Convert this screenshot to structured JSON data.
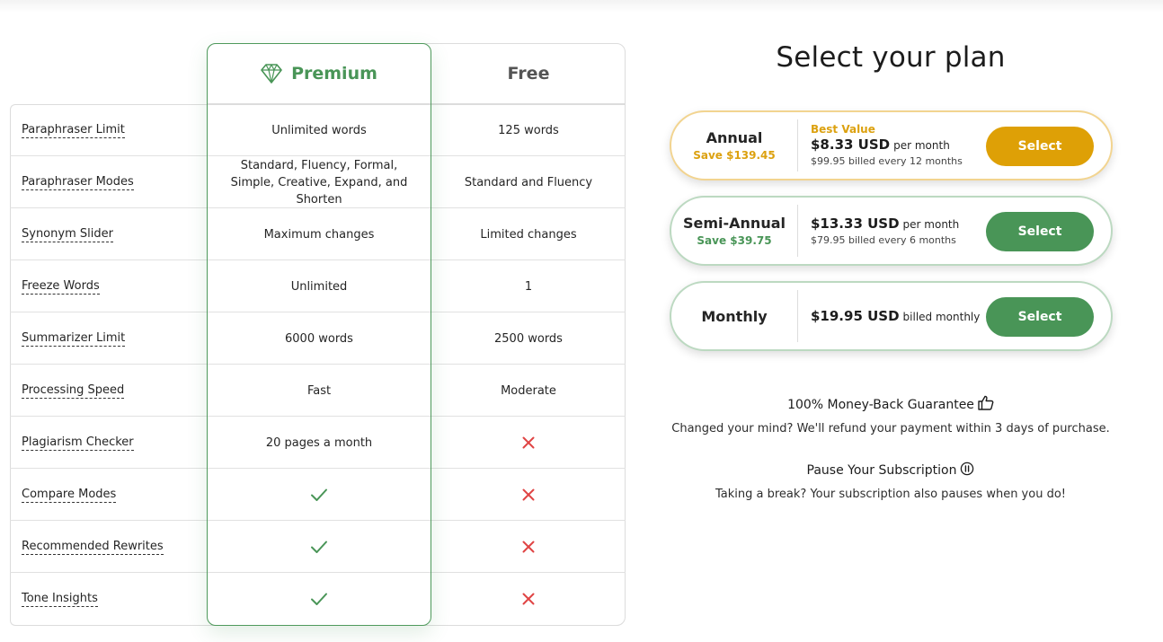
{
  "colors": {
    "brand_green": "#499557",
    "gold": "#dea006",
    "cross_red": "#e04444"
  },
  "comparison": {
    "premium_label": "Premium",
    "premium_icon": "diamond-icon",
    "free_label": "Free",
    "rows": [
      {
        "feature": "Paraphraser Limit",
        "premium": "Unlimited words",
        "free": "125 words"
      },
      {
        "feature": "Paraphraser Modes",
        "premium": "Standard, Fluency, Formal, Simple, Creative, Expand, and Shorten",
        "free": "Standard and Fluency"
      },
      {
        "feature": "Synonym Slider",
        "premium": "Maximum changes",
        "free": "Limited changes"
      },
      {
        "feature": "Freeze Words",
        "premium": "Unlimited",
        "free": "1"
      },
      {
        "feature": "Summarizer Limit",
        "premium": "6000 words",
        "free": "2500 words"
      },
      {
        "feature": "Processing Speed",
        "premium": "Fast",
        "free": "Moderate"
      },
      {
        "feature": "Plagiarism Checker",
        "premium": "20 pages a month",
        "free": "cross-icon"
      },
      {
        "feature": "Compare Modes",
        "premium": "check-icon",
        "free": "cross-icon"
      },
      {
        "feature": "Recommended Rewrites",
        "premium": "check-icon",
        "free": "cross-icon"
      },
      {
        "feature": "Tone Insights",
        "premium": "check-icon",
        "free": "cross-icon"
      }
    ]
  },
  "plans": {
    "title": "Select your plan",
    "annual": {
      "name": "Annual",
      "save": "Save $139.45",
      "badge": "Best Value",
      "price": "$8.33 USD",
      "period": "per month",
      "billing": "$99.95 billed every 12 months",
      "button": "Select"
    },
    "semi": {
      "name": "Semi-Annual",
      "save": "Save $39.75",
      "price": "$13.33 USD",
      "period": "per month",
      "billing": "$79.95 billed every 6 months",
      "button": "Select"
    },
    "monthly": {
      "name": "Monthly",
      "price": "$19.95 USD",
      "period": "billed monthly",
      "button": "Select"
    }
  },
  "guarantee": {
    "title": "100% Money-Back Guarantee",
    "title_icon": "thumbs-up-icon",
    "text": "Changed your mind? We'll refund your payment within 3 days of purchase."
  },
  "pause": {
    "title": "Pause Your Subscription",
    "title_icon": "pause-circle-icon",
    "text": "Taking a break? Your subscription also pauses when you do!"
  }
}
